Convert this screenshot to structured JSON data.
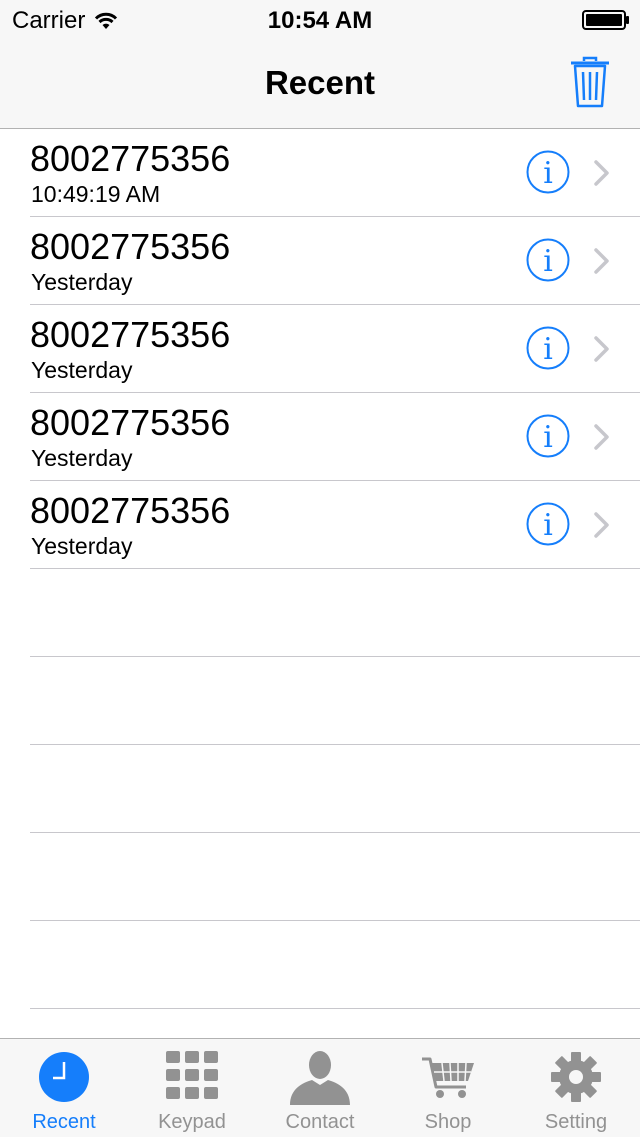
{
  "status_bar": {
    "carrier": "Carrier",
    "time": "10:54 AM"
  },
  "nav": {
    "title": "Recent",
    "trash_icon": "trash-icon"
  },
  "recents": [
    {
      "number": "8002775356",
      "subtitle": "10:49:19 AM"
    },
    {
      "number": "8002775356",
      "subtitle": "Yesterday"
    },
    {
      "number": "8002775356",
      "subtitle": "Yesterday"
    },
    {
      "number": "8002775356",
      "subtitle": "Yesterday"
    },
    {
      "number": "8002775356",
      "subtitle": "Yesterday"
    }
  ],
  "tabs": [
    {
      "label": "Recent",
      "icon": "clock-icon",
      "active": true
    },
    {
      "label": "Keypad",
      "icon": "keypad-icon",
      "active": false
    },
    {
      "label": "Contact",
      "icon": "person-icon",
      "active": false
    },
    {
      "label": "Shop",
      "icon": "cart-icon",
      "active": false
    },
    {
      "label": "Setting",
      "icon": "gear-icon",
      "active": false
    }
  ],
  "colors": {
    "accent": "#157efb",
    "inactive": "#929292",
    "bar_bg": "#f7f7f7",
    "separator": "#c8c7cc",
    "chevron": "#c7c7cc"
  }
}
